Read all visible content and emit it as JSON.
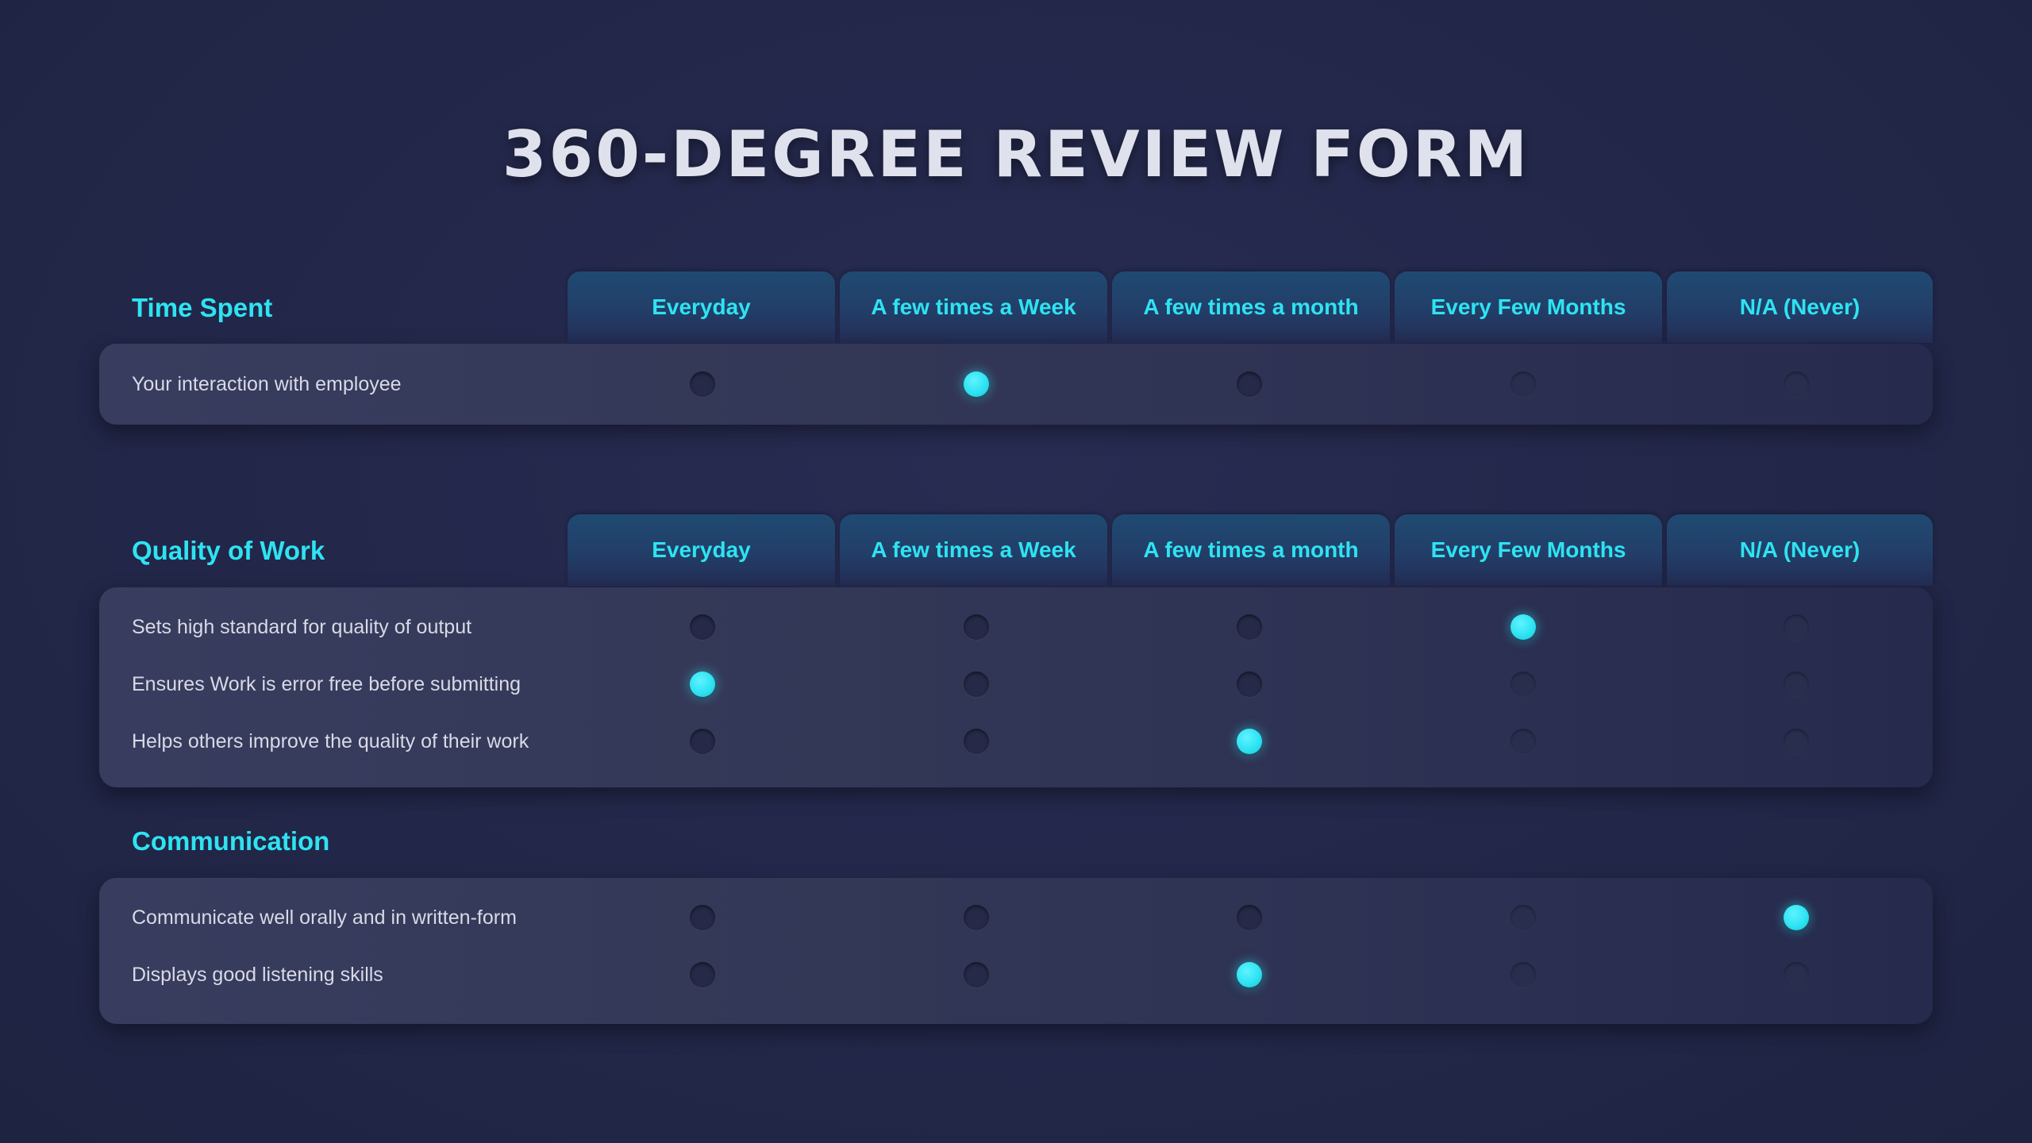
{
  "title": "360-DEGREE REVIEW FORM",
  "accent_color": "#2ee3f2",
  "sections": [
    {
      "label": "Time Spent",
      "columns": [
        "Everyday",
        "A few times a Week",
        "A few times a month",
        "Every Few Months",
        "N/A (Never)"
      ],
      "rows": [
        {
          "label": "Your interaction with employee",
          "selected": "A few times a Week"
        }
      ]
    },
    {
      "label": "Quality of Work",
      "columns": [
        "Everyday",
        "A few times a Week",
        "A few times a month",
        "Every Few Months",
        "N/A (Never)"
      ],
      "rows": [
        {
          "label": "Sets high standard for quality of output",
          "selected": "Every Few Months"
        },
        {
          "label": "Ensures Work is error free before submitting",
          "selected": "Everyday"
        },
        {
          "label": "Helps others improve the quality of their work",
          "selected": "A few times a month"
        }
      ]
    },
    {
      "label": "Communication",
      "rows": [
        {
          "label": "Communicate well orally and in written-form",
          "selected": "N/A (Never)"
        },
        {
          "label": "Displays good listening skills",
          "selected": "A few times a month"
        }
      ]
    }
  ]
}
